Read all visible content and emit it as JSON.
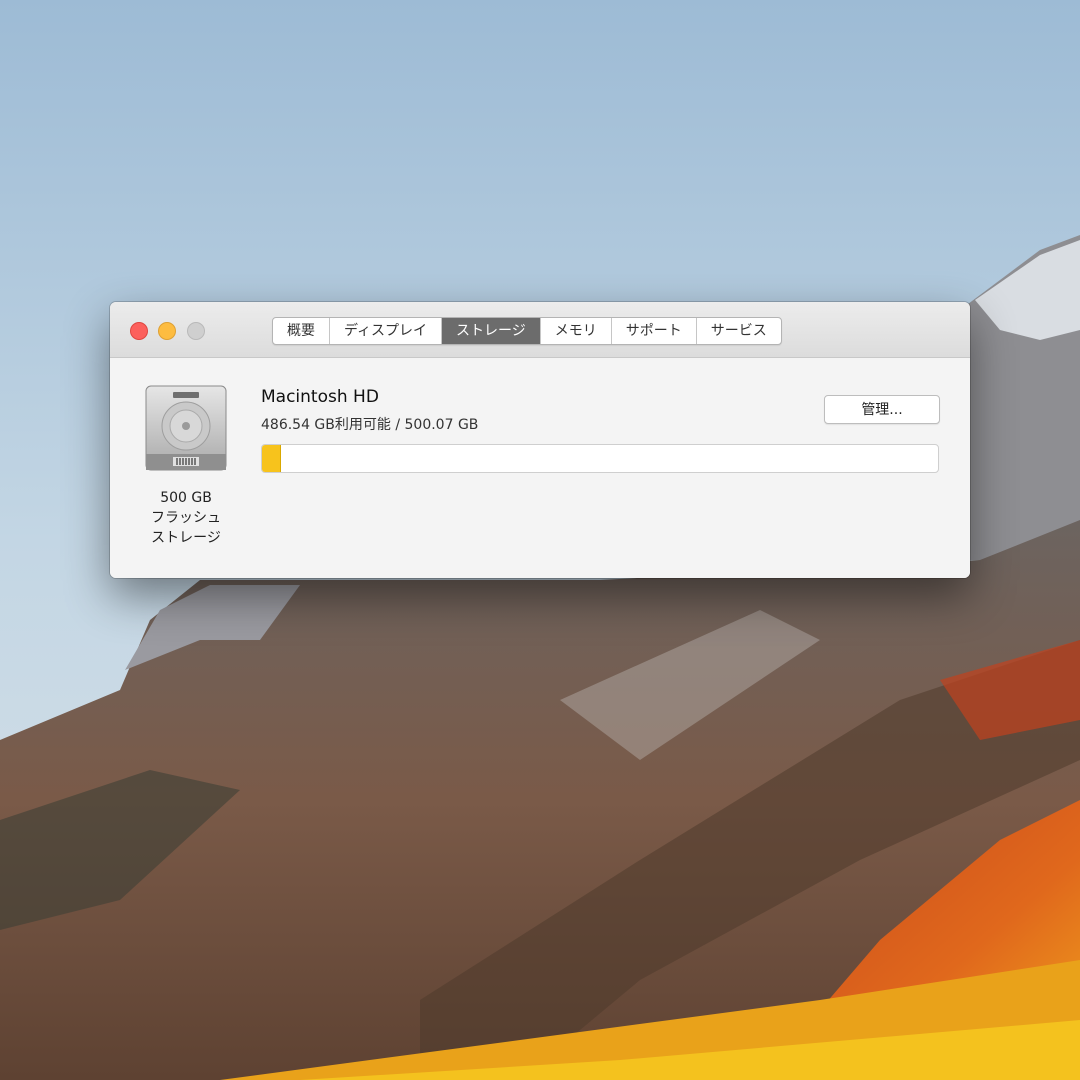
{
  "window": {
    "tabs": [
      {
        "label": "概要",
        "active": false
      },
      {
        "label": "ディスプレイ",
        "active": false
      },
      {
        "label": "ストレージ",
        "active": true
      },
      {
        "label": "メモリ",
        "active": false
      },
      {
        "label": "サポート",
        "active": false
      },
      {
        "label": "サービス",
        "active": false
      }
    ]
  },
  "storage": {
    "disk_icon": "hard-drive-icon",
    "disk_caption": [
      "500 GB",
      "フラッシュ",
      "ストレージ"
    ],
    "volume_name": "Macintosh HD",
    "availability": "486.54 GB利用可能 / 500.07 GB",
    "manage_label": "管理...",
    "used_fraction": 0.027,
    "bar_color": "#f7c31c"
  }
}
